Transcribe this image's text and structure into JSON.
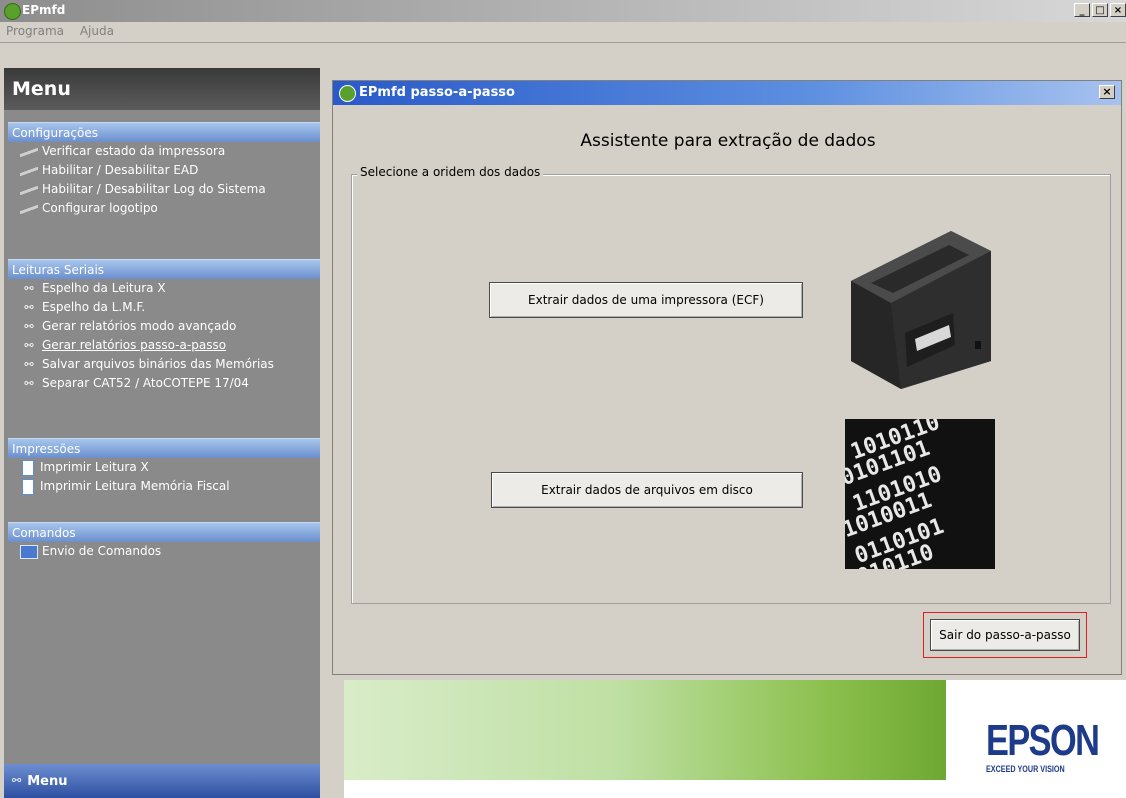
{
  "window": {
    "title": "EPmfd",
    "buttons": [
      "_",
      "□",
      "×"
    ]
  },
  "menubar": {
    "items": [
      "Programa",
      "Ajuda"
    ]
  },
  "sidebar": {
    "title": "Menu",
    "sections": [
      {
        "label": "Configurações",
        "items": [
          "Verificar estado da impressora",
          "Habilitar / Desabilitar EAD",
          "Habilitar / Desabilitar Log do Sistema",
          "Configurar logotipo"
        ]
      },
      {
        "label": "Leituras Seriais",
        "items": [
          "Espelho da Leitura X",
          "Espelho da L.M.F.",
          "Gerar relatórios modo avançado",
          "Gerar relatórios passo-a-passo",
          "Salvar arquivos binários das Memórias",
          "Separar CAT52 / AtoCOTEPE 17/04"
        ]
      },
      {
        "label": "Impressões",
        "items": [
          "Imprimir Leitura X",
          "Imprimir Leitura Memória Fiscal"
        ]
      },
      {
        "label": "Comandos",
        "items": [
          "Envio de Comandos"
        ]
      }
    ],
    "footer_label": "Menu"
  },
  "dialog": {
    "title": "EPmfd passo-a-passo",
    "close_label": "×",
    "heading": "Assistente para extração de dados",
    "group_label": "Selecione a oridem dos dados",
    "btn_ecf": "Extrair dados de uma impressora (ECF)",
    "btn_disk": "Extrair dados de arquivos em disco",
    "btn_exit": "Sair do passo-a-passo"
  },
  "banner": {
    "logo": "EPSON",
    "tagline": "EXCEED YOUR VISION"
  },
  "icons": {
    "pen": "pen-icon",
    "reel": "film-reel-icon",
    "doc": "document-icon",
    "pc": "computer-icon"
  }
}
